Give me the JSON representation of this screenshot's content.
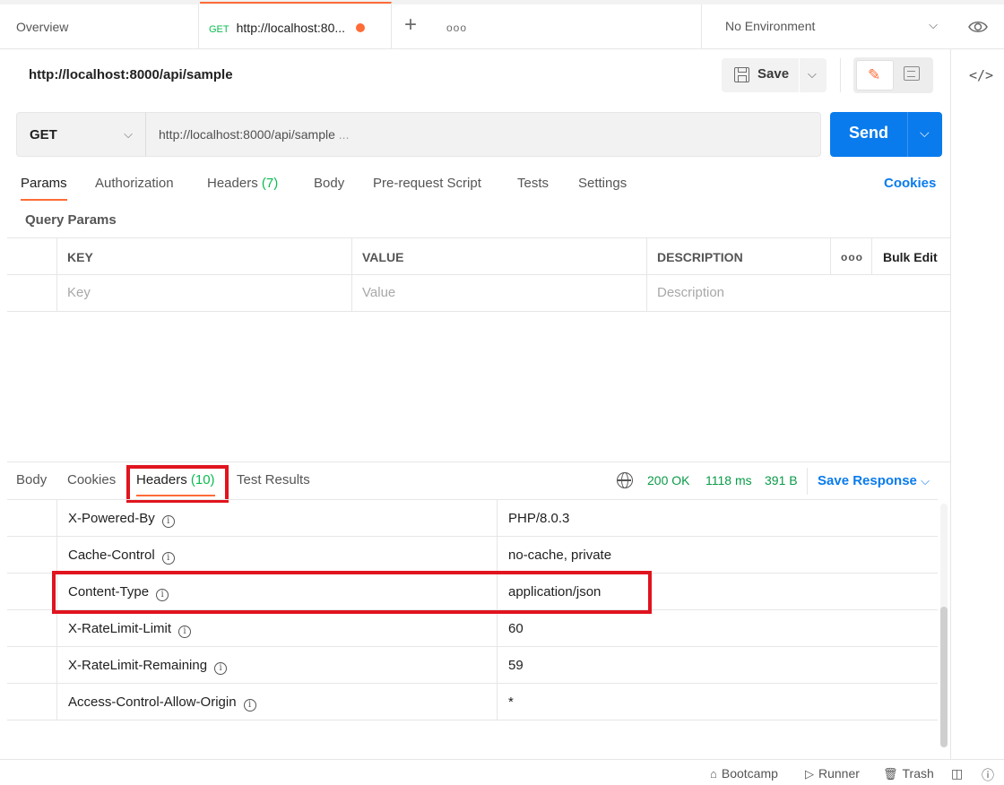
{
  "tabs": {
    "overview": "Overview",
    "request_method": "GET",
    "request_label": "http://localhost:80...",
    "plus": "+",
    "more": "ooo"
  },
  "environment": {
    "label": "No Environment"
  },
  "request": {
    "title": "http://localhost:8000/api/sample",
    "method": "GET",
    "url": "http://localhost:8000/api/sample",
    "url_ellipsis": " ...",
    "save_label": "Save",
    "send_label": "Send"
  },
  "request_tabs": [
    {
      "label": "Params"
    },
    {
      "label": "Authorization"
    },
    {
      "label": "Headers",
      "count": "(7)"
    },
    {
      "label": "Body"
    },
    {
      "label": "Pre-request Script"
    },
    {
      "label": "Tests"
    },
    {
      "label": "Settings"
    }
  ],
  "cookies_link": "Cookies",
  "query_params": {
    "title": "Query Params",
    "columns": [
      "KEY",
      "VALUE",
      "DESCRIPTION"
    ],
    "more": "ooo",
    "bulk_edit": "Bulk Edit",
    "placeholders": [
      "Key",
      "Value",
      "Description"
    ]
  },
  "response": {
    "tabs": [
      {
        "label": "Body"
      },
      {
        "label": "Cookies"
      },
      {
        "label": "Headers",
        "count": "(10)"
      },
      {
        "label": "Test Results"
      }
    ],
    "status": "200 OK",
    "time": "1118 ms",
    "size": "391 B",
    "save_response": "Save Response",
    "headers": [
      {
        "key": "X-Powered-By",
        "value": "PHP/8.0.3"
      },
      {
        "key": "Cache-Control",
        "value": "no-cache, private"
      },
      {
        "key": "Content-Type",
        "value": "application/json"
      },
      {
        "key": "X-RateLimit-Limit",
        "value": "60"
      },
      {
        "key": "X-RateLimit-Remaining",
        "value": "59"
      },
      {
        "key": "Access-Control-Allow-Origin",
        "value": "*"
      }
    ]
  },
  "statusbar": {
    "bootcamp": "Bootcamp",
    "runner": "Runner",
    "trash": "Trash"
  },
  "colors": {
    "accent": "#ff6c37",
    "send": "#097bed",
    "success": "#0cbb52",
    "highlight": "#e0141e"
  }
}
